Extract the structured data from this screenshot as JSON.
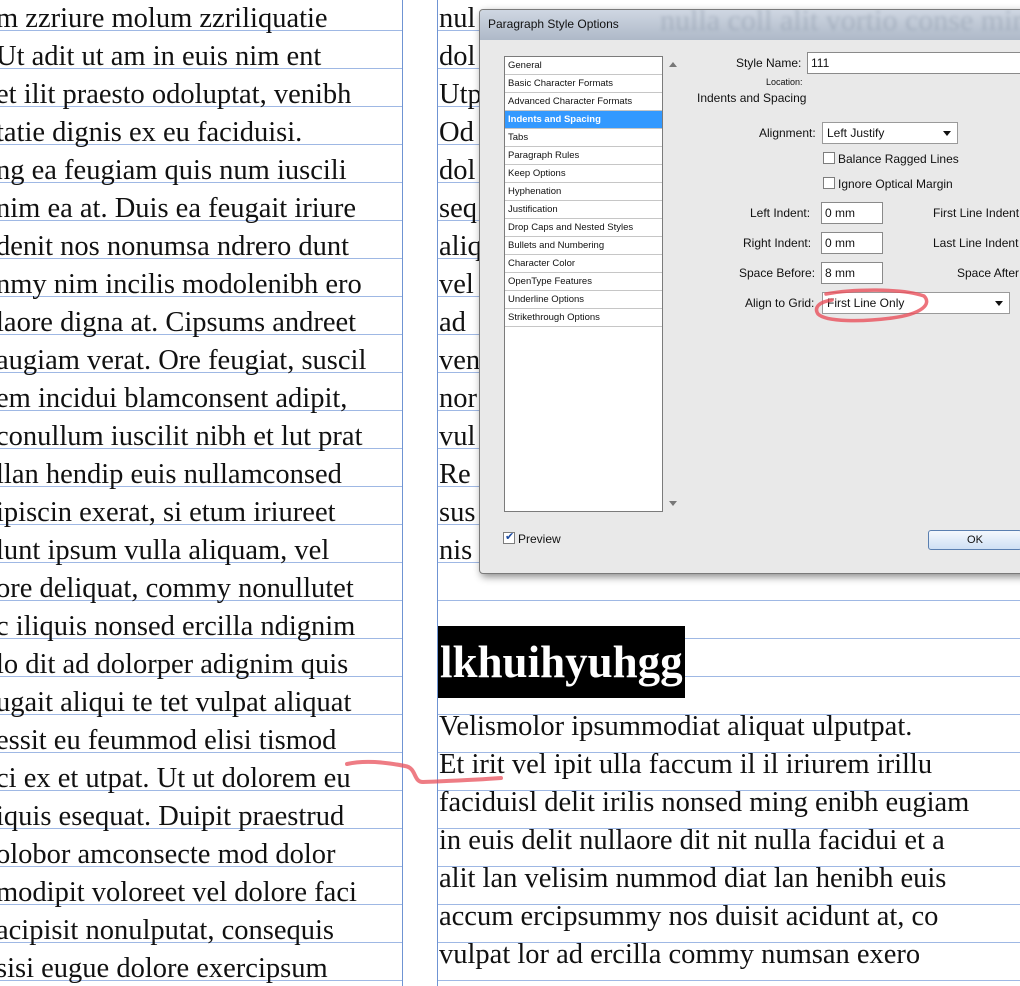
{
  "left_column": {
    "lines": [
      "m zzriure molum zzriliquatie",
      " Ut adit ut am in euis nim ent",
      "et ilit praesto odoluptat, venibh",
      "tatie dignis ex eu faciduisi.",
      "ng ea feugiam quis num iuscili",
      "nim ea at. Duis ea feugait iriure",
      "denit nos nonumsa ndrero dunt",
      "nmy nim incilis modolenibh ero",
      "laore digna at. Cipsums andreet",
      "augiam verat. Ore feugiat, suscil",
      "em incidui blamconsent adipit,",
      "conullum iuscilit nibh et lut prat",
      "llan hendip euis nullamconsed",
      " ipiscin exerat, si etum iriureet",
      "lunt ipsum vulla aliquam, vel",
      "ore deliquat, commy nonullutet",
      "c iliquis nonsed ercilla ndignim",
      "lo dit ad dolorper adignim quis",
      "ugait aliqui te tet vulpat aliquat",
      "essit eu feummod elisi tismod",
      "ci ex et utpat. Ut ut dolorem eu",
      "iquis esequat. Duipit praestrud",
      "olobor amconsecte mod dolor",
      "modipit voloreet vel dolore faci",
      "acipisit nonulputat, consequis",
      " sisi eugue dolore exercipsum"
    ]
  },
  "right_column": {
    "top_lines": [
      "nul",
      "dol",
      "Utp",
      "Od",
      "dol",
      "seq",
      "aliq",
      "vel",
      "ad",
      "ven",
      "nor",
      "vul",
      "Re",
      "sus",
      "nis"
    ],
    "heading": "lkhuihyuhgg",
    "body_lines": [
      "Velismolor ipsummodiat aliquat ulputpat.",
      "Et irit vel ipit ulla faccum il il iriurem irillu",
      "faciduisl delit irilis nonsed ming enibh eugiam",
      "in euis delit nullaore dit nit nulla facidui et a",
      "alit lan velisim nummod diat lan henibh euis",
      "accum ercipsummy nos duisit acidunt at, co",
      "vulpat lor ad ercilla commy numsan exero"
    ]
  },
  "dialog": {
    "title": "Paragraph Style Options",
    "title_background_text": "nulla coll alit vortio conse minci criustrud",
    "categories": [
      "General",
      "Basic Character Formats",
      "Advanced Character Formats",
      "Indents and Spacing",
      "Tabs",
      "Paragraph Rules",
      "Keep Options",
      "Hyphenation",
      "Justification",
      "Drop Caps and Nested Styles",
      "Bullets and Numbering",
      "Character Color",
      "OpenType Features",
      "Underline Options",
      "Strikethrough Options"
    ],
    "selected_category_index": 3,
    "style_name_label": "Style Name:",
    "style_name_value": "111",
    "location_label": "Location:",
    "section_title": "Indents and Spacing",
    "alignment_label": "Alignment:",
    "alignment_value": "Left Justify",
    "balance_ragged_label": "Balance Ragged Lines",
    "balance_ragged_checked": false,
    "ignore_optical_label": "Ignore Optical Margin",
    "ignore_optical_checked": false,
    "left_indent_label": "Left Indent:",
    "left_indent_value": "0 mm",
    "first_line_indent_label": "First Line Indent",
    "right_indent_label": "Right Indent:",
    "right_indent_value": "0 mm",
    "last_line_indent_label": "Last Line Indent",
    "space_before_label": "Space Before:",
    "space_before_value": "8 mm",
    "space_after_label": "Space After",
    "align_grid_label": "Align to Grid:",
    "align_grid_value": "First Line Only",
    "preview_label": "Preview",
    "preview_checked": true,
    "ok_label": "OK"
  },
  "annotation_color": "#e8505b",
  "guide_color": "#6f94d3"
}
